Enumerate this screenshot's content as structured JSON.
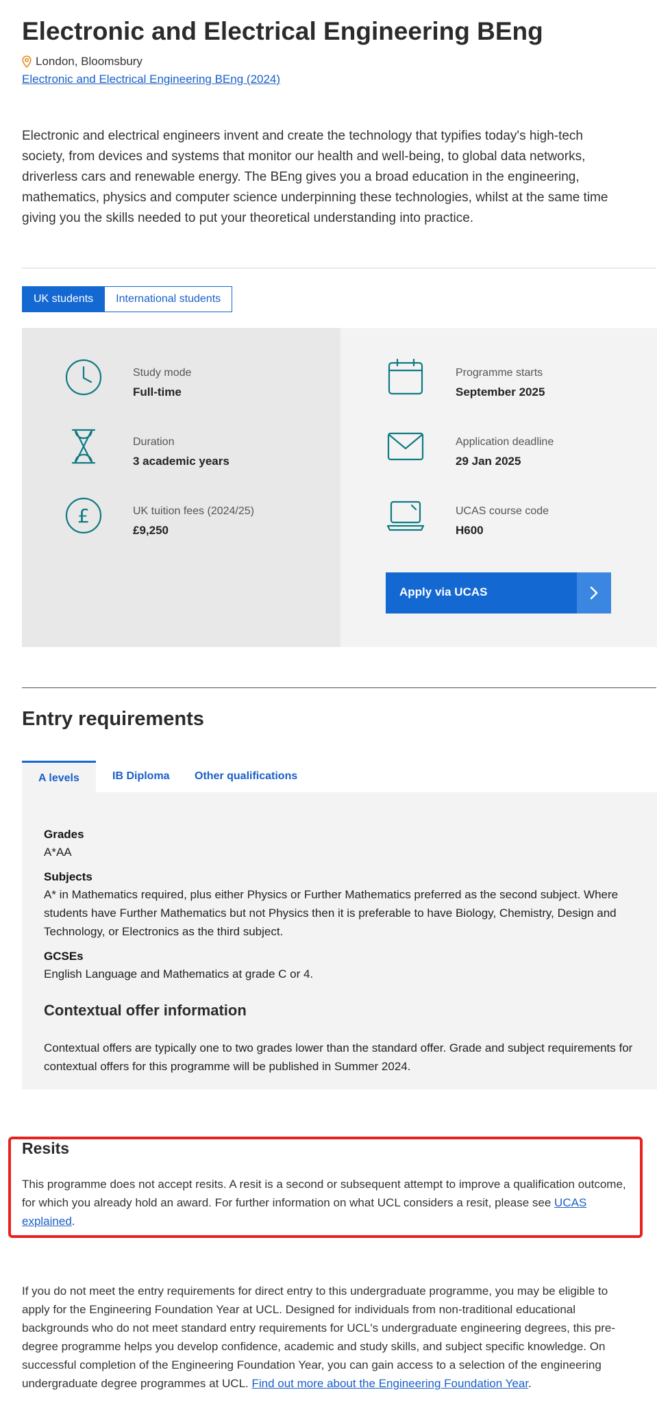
{
  "page": {
    "title": "Electronic and Electrical Engineering BEng",
    "location": "London, Bloomsbury",
    "previous_year_link": "Electronic and Electrical Engineering BEng (2024)",
    "intro": "Electronic and electrical engineers invent and create the technology that typifies today's high-tech society, from devices and systems that monitor our health and well-being, to global data networks, driverless cars and renewable energy. The BEng gives you a broad education in the engineering, mathematics, physics and computer science underpinning these technologies, whilst at the same time giving you the skills needed to put your theoretical understanding into practice."
  },
  "audience_tabs": [
    {
      "label": "UK students",
      "active": true
    },
    {
      "label": "International students",
      "active": false
    }
  ],
  "key_facts": {
    "study_mode": {
      "label": "Study mode",
      "value": "Full-time",
      "icon": "clock-icon"
    },
    "duration": {
      "label": "Duration",
      "value": "3 academic years",
      "icon": "hourglass-icon"
    },
    "fees": {
      "label": "UK tuition fees (2024/25)",
      "value": "£9,250",
      "icon": "pound-icon"
    },
    "starts": {
      "label": "Programme starts",
      "value": "September 2025",
      "icon": "calendar-icon"
    },
    "deadline": {
      "label": "Application deadline",
      "value": "29 Jan 2025",
      "icon": "envelope-icon"
    },
    "ucas_code": {
      "label": "UCAS course code",
      "value": "H600",
      "icon": "laptop-icon"
    },
    "apply_button": "Apply via UCAS"
  },
  "entry": {
    "heading": "Entry requirements",
    "tabs": [
      {
        "label": "A levels",
        "active": true
      },
      {
        "label": "IB Diploma",
        "active": false
      },
      {
        "label": "Other qualifications",
        "active": false
      }
    ],
    "grades_heading": "Grades",
    "grades_value": "A*AA",
    "subjects_heading": "Subjects",
    "subjects_value": "A* in Mathematics required, plus either Physics or Further Mathematics preferred as the second subject. Where students have Further Mathematics but not Physics then it is preferable to have Biology, Chemistry, Design and Technology, or Electronics as the third subject.",
    "gcse_heading": "GCSEs",
    "gcse_value": "English Language and Mathematics at grade C or 4.",
    "contextual_heading": "Contextual offer information",
    "contextual_text": "Contextual offers are typically one to two grades lower than the standard offer. Grade and subject requirements for contextual offers for this programme will be published in Summer 2024."
  },
  "resits": {
    "heading": "Resits",
    "text": "This programme does not accept resits. A resit is a second or subsequent attempt to improve a qualification outcome, for which you already hold an award. For further information on what UCL considers a resit, please see ",
    "link": "UCAS explained",
    "after": "."
  },
  "foundation": {
    "text": "If you do not meet the entry requirements for direct entry to this undergraduate programme, you may be eligible to apply for the Engineering Foundation Year at UCL. Designed for individuals from non-traditional educational backgrounds who do not meet standard entry requirements for UCL's undergraduate engineering degrees, this pre-degree programme helps you develop confidence, academic and study skills, and subject specific knowledge. On successful completion of the Engineering Foundation Year, you can gain access to a selection of the engineering undergraduate degree programmes at UCL. ",
    "link": "Find out more about the Engineering Foundation Year",
    "after": "."
  },
  "colors": {
    "brand_blue": "#1468d2",
    "icon_teal": "#0f7a82",
    "highlight_red": "#e8211e"
  }
}
